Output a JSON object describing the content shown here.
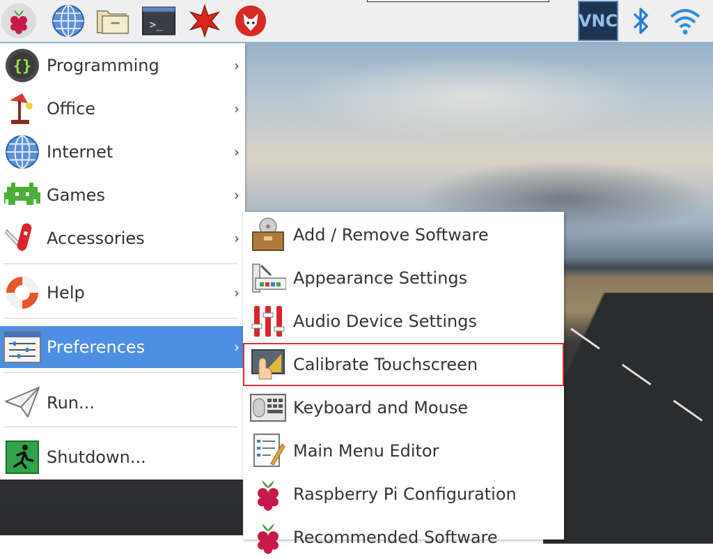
{
  "taskbar": {
    "apps": [
      {
        "icon": "raspberry-menu-icon"
      },
      {
        "icon": "web-browser-icon"
      },
      {
        "icon": "file-manager-icon"
      },
      {
        "icon": "terminal-icon"
      },
      {
        "icon": "mathematica-icon"
      },
      {
        "icon": "wolfram-icon"
      }
    ],
    "terminal_prompt": ">_",
    "tray": [
      {
        "icon": "vnc-icon",
        "label": "VNC"
      },
      {
        "icon": "bluetooth-icon"
      },
      {
        "icon": "wifi-icon"
      }
    ]
  },
  "main_menu": {
    "items": [
      {
        "label": "Programming",
        "icon": "programming-icon",
        "submenu": true
      },
      {
        "label": "Office",
        "icon": "office-icon",
        "submenu": true
      },
      {
        "label": "Internet",
        "icon": "internet-icon",
        "submenu": true
      },
      {
        "label": "Games",
        "icon": "games-icon",
        "submenu": true
      },
      {
        "label": "Accessories",
        "icon": "accessories-icon",
        "submenu": true
      },
      {
        "label": "Help",
        "icon": "help-icon",
        "submenu": true
      },
      {
        "label": "Preferences",
        "icon": "preferences-icon",
        "submenu": true,
        "selected": true
      },
      {
        "label": "Run...",
        "icon": "run-icon",
        "submenu": false
      },
      {
        "label": "Shutdown...",
        "icon": "shutdown-icon",
        "submenu": false
      }
    ],
    "arrow": "›"
  },
  "preferences_submenu": {
    "items": [
      {
        "label": "Add / Remove Software",
        "icon": "add-remove-software-icon"
      },
      {
        "label": "Appearance Settings",
        "icon": "appearance-settings-icon"
      },
      {
        "label": "Audio Device Settings",
        "icon": "audio-settings-icon"
      },
      {
        "label": "Calibrate Touchscreen",
        "icon": "calibrate-touchscreen-icon",
        "highlighted": true
      },
      {
        "label": "Keyboard and Mouse",
        "icon": "keyboard-mouse-icon"
      },
      {
        "label": "Main Menu Editor",
        "icon": "menu-editor-icon"
      },
      {
        "label": "Raspberry Pi Configuration",
        "icon": "raspberry-pi-config-icon"
      },
      {
        "label": "Recommended Software",
        "icon": "recommended-software-icon"
      }
    ]
  },
  "colors": {
    "selection": "#4d8fe3",
    "highlight_border": "#d8322c",
    "taskbar_bg": "#efefef"
  }
}
